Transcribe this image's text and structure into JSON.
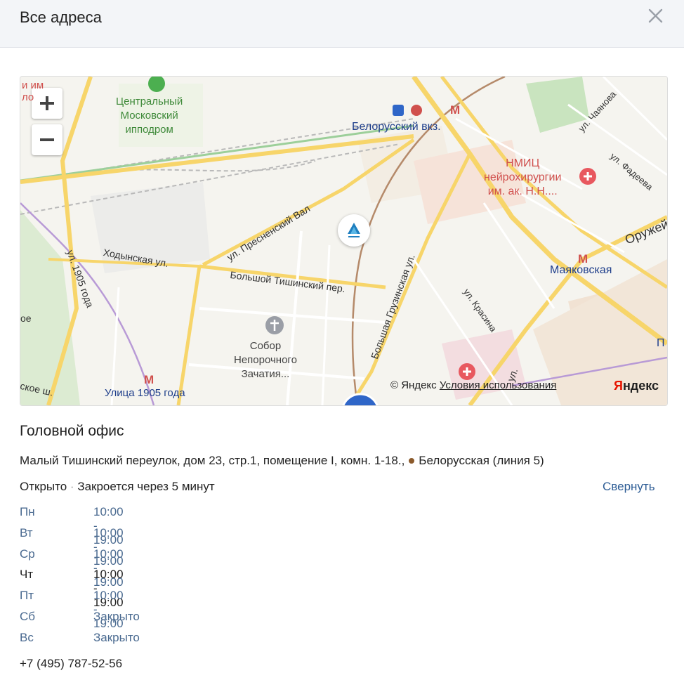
{
  "header": {
    "title": "Все адреса"
  },
  "map": {
    "labels": {
      "hippodrome": "Центральный\nМосковский\nипподром",
      "belorussky": "Белорусский вкз.",
      "nmic": "НМИЦ\nнейрохирургии\nим. ак. Н.Н....",
      "chayanova": "ул. Чаянова",
      "fadeeva": "ул. Фадеева",
      "oruzh": "Оружей",
      "mayakovskaya": "Маяковская",
      "presnensky": "ул. Пресненский Вал",
      "khodynskaya": "Ходынская ул.",
      "ul1905": "ул. 1905 года",
      "bolshoy_tishinsky": "Большой Тишинский пер.",
      "b_gruzinskaya": "Большая Грузинская ул.",
      "krasina": "ул. Красина",
      "sobor": "Собор\nНепорочного\nЗачатия...",
      "ulitsa1905": "Улица 1905 года",
      "skoe_sh": "ское ш.",
      "frag_oe": "ое",
      "frag_ul": "ул.",
      "frag_p": "П",
      "frag_im": "и им\nло"
    },
    "copyright": "© Яндекс",
    "terms": "Условия использования",
    "logo": "Яндекс"
  },
  "office": {
    "title": "Головной офис",
    "address": "Малый Тишинский переулок, дом 23, стр.1, помещение I, комн. 1-18.,",
    "metro": "Белорусская (линия 5)",
    "status_open": "Открыто",
    "status_sep": "·",
    "status_close": "Закроется через 5 минут",
    "collapse": "Свернуть",
    "hours": [
      {
        "day": "Пн",
        "time": "10:00 - 19:00"
      },
      {
        "day": "Вт",
        "time": "10:00 - 19:00"
      },
      {
        "day": "Ср",
        "time": "10:00 - 19:00"
      },
      {
        "day": "Чт",
        "time": "10:00 - 19:00",
        "today": true
      },
      {
        "day": "Пт",
        "time": "10:00 - 19:00"
      },
      {
        "day": "Сб",
        "time": "Закрыто"
      },
      {
        "day": "Вс",
        "time": "Закрыто"
      }
    ],
    "phone": "+7 (495) 787-52-56"
  },
  "colors": {
    "link": "#2f5e96",
    "metro_line_5": "#8b5a2b",
    "metro_red": "#d0504d",
    "road_major": "#f7d56a"
  }
}
